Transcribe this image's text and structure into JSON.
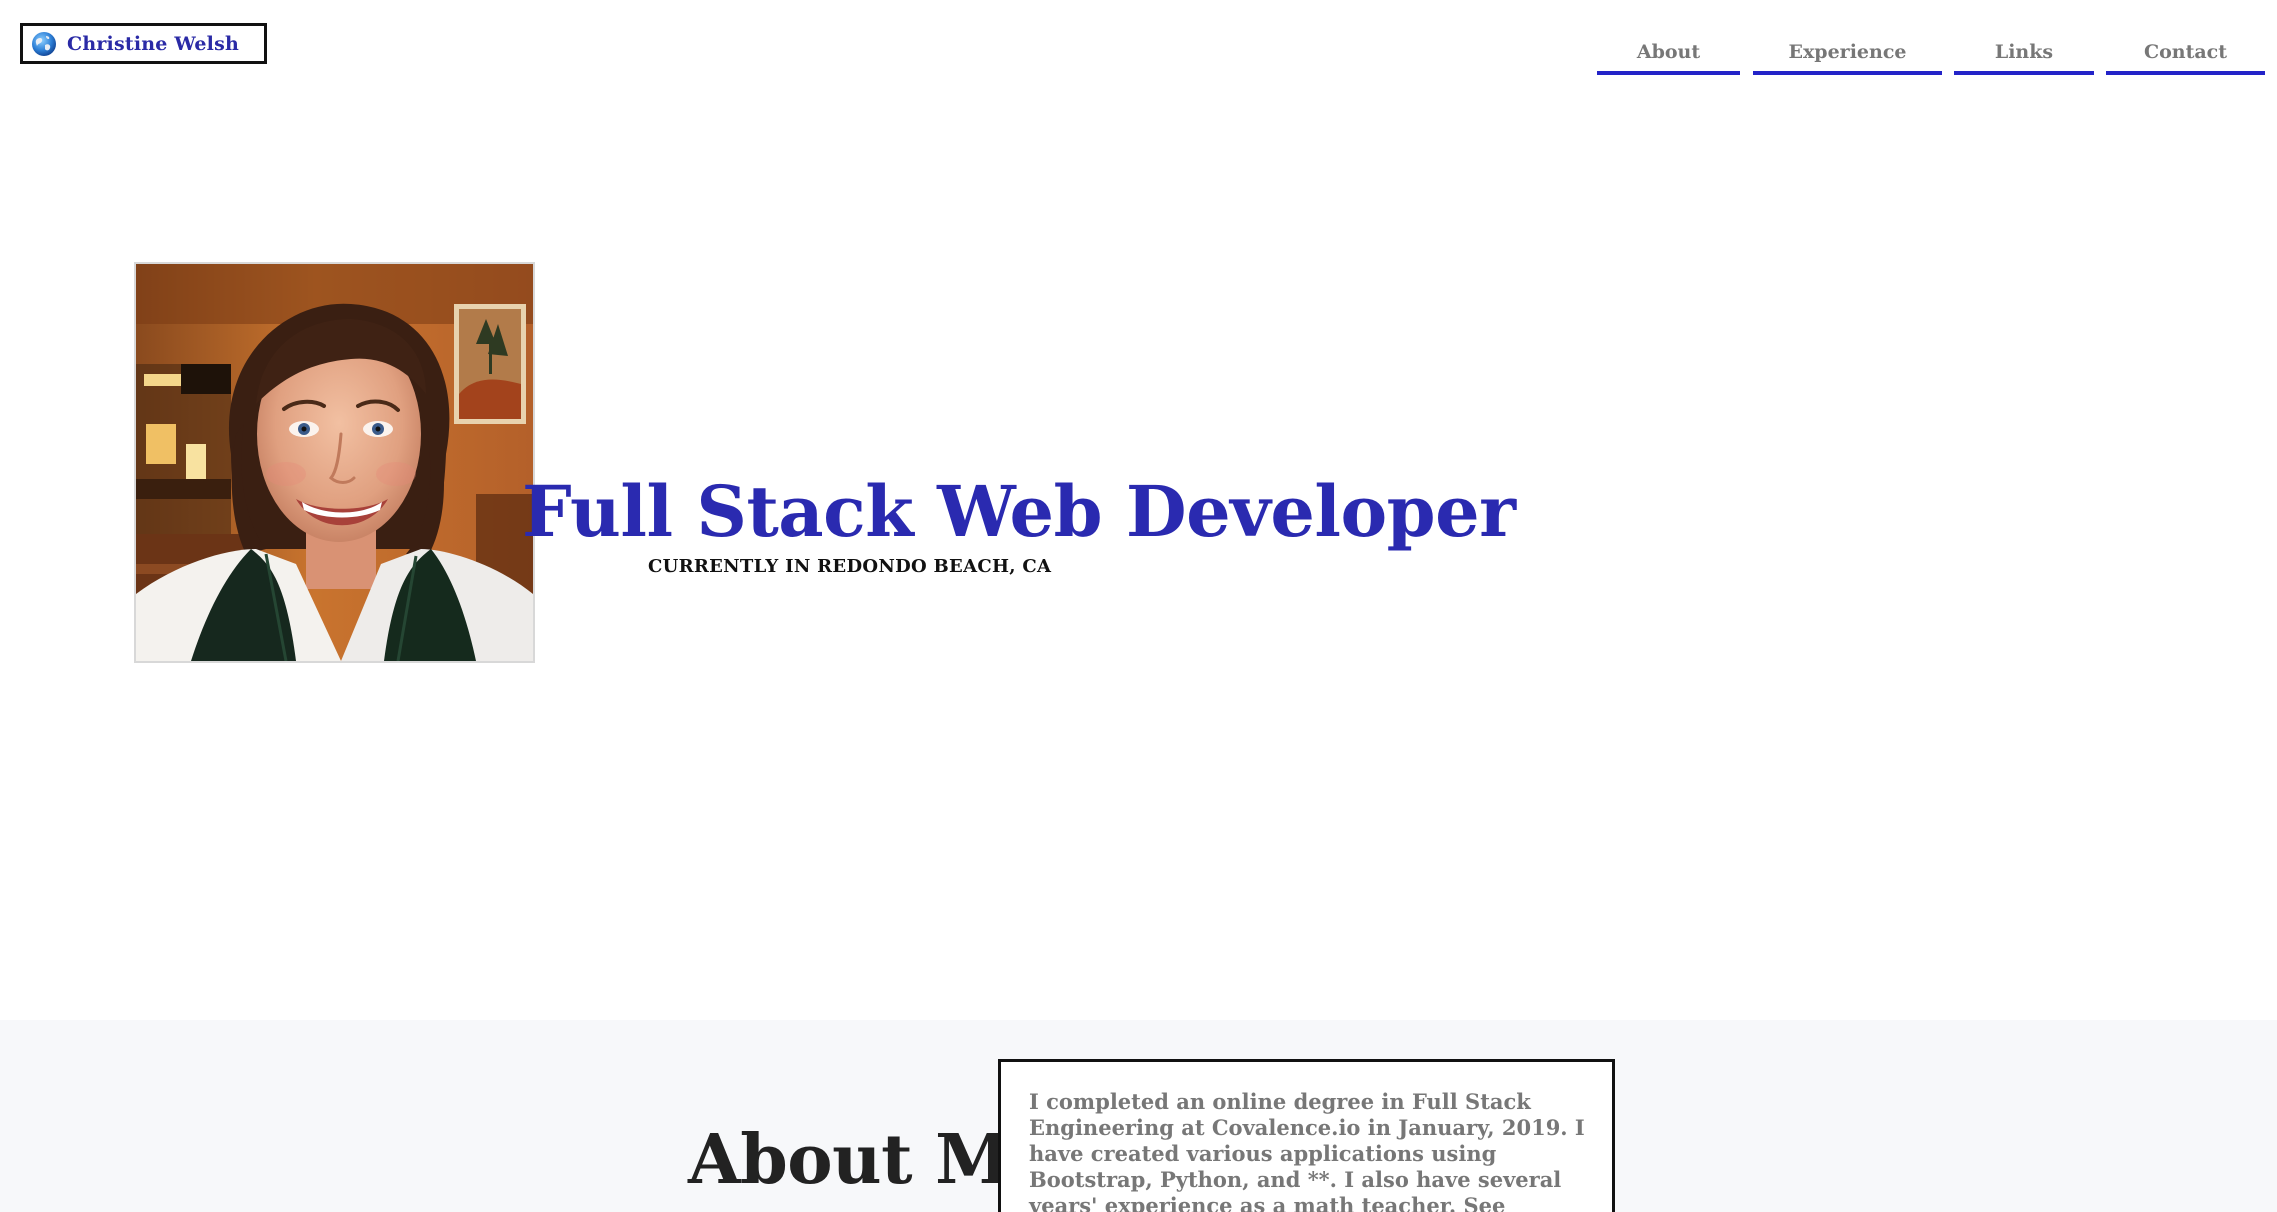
{
  "header": {
    "brand_name": "Christine Welsh",
    "brand_icon": "globe-icon"
  },
  "nav": {
    "items": [
      {
        "label": "About"
      },
      {
        "label": "Experience"
      },
      {
        "label": "Links"
      },
      {
        "label": "Contact"
      }
    ],
    "accent_color": "#2323c8"
  },
  "hero": {
    "title": "Full Stack Web Developer",
    "subtitle": "CURRENTLY IN REDONDO BEACH, CA",
    "title_color": "#2a2ab0"
  },
  "about": {
    "heading": "About Me",
    "text": "I completed an online degree in Full Stack Engineering at Covalence.io in January, 2019. I have created various applications using Bootstrap, Python, and **. I also have several years' experience as a math teacher. See details of my work and links to my"
  }
}
